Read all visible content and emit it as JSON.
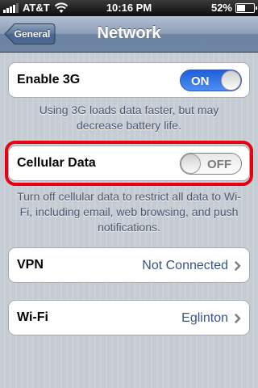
{
  "status_bar": {
    "carrier": "AT&T",
    "time": "10:16 PM",
    "battery": "52%",
    "battery_level": 0.52,
    "signal_bars": 4,
    "icons": [
      "signal-icon",
      "wifi-icon",
      "battery-icon"
    ]
  },
  "nav": {
    "back_label": "General",
    "title": "Network"
  },
  "enable_3g": {
    "label": "Enable 3G",
    "state": "ON",
    "on": true,
    "footnote": "Using 3G loads data faster, but may decrease battery life."
  },
  "cellular_data": {
    "label": "Cellular Data",
    "state": "OFF",
    "on": false,
    "footnote": "Turn off cellular data to restrict all data to Wi-Fi, including email, web browsing, and push notifications.",
    "highlight_color": "#e60012"
  },
  "vpn": {
    "label": "VPN",
    "value": "Not Connected"
  },
  "wifi": {
    "label": "Wi-Fi",
    "value": "Eglinton"
  },
  "colors": {
    "nav_bar": "#6d84a2",
    "switch_on": "#2a6be4",
    "value_text": "#385487",
    "background": "#c5ccd4"
  }
}
